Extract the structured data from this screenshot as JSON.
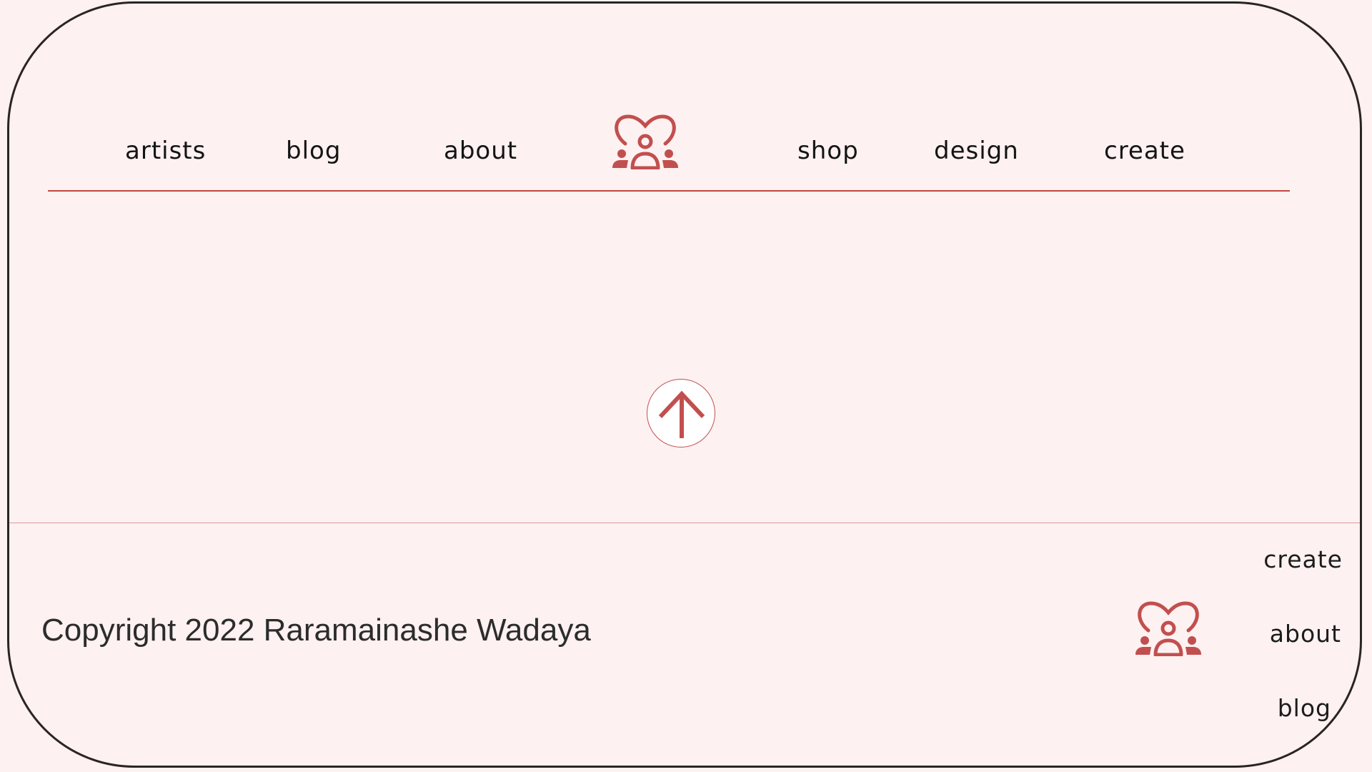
{
  "nav": {
    "links": [
      {
        "label": "artists"
      },
      {
        "label": "blog"
      },
      {
        "label": "about"
      },
      {
        "label": "shop"
      },
      {
        "label": "design"
      },
      {
        "label": "create"
      }
    ],
    "logo_icon": "heart-community-icon"
  },
  "scroll_top": {
    "icon": "arrow-up-icon"
  },
  "footer": {
    "copyright": "Copyright 2022 Raramainashe Wadaya",
    "logo_icon": "heart-community-icon",
    "links": [
      {
        "label": "create"
      },
      {
        "label": "about"
      },
      {
        "label": "blog"
      }
    ]
  },
  "colors": {
    "background": "#fdf1f1",
    "accent": "#c24f4f",
    "nav_rule": "#c0463f",
    "text": "#141414",
    "frame_border": "#2a2424"
  }
}
